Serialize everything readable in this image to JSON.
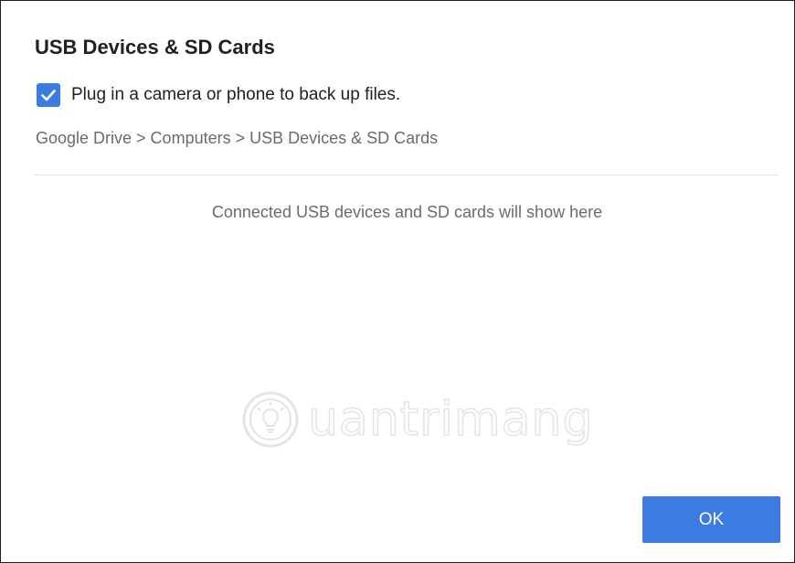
{
  "dialog": {
    "title": "USB Devices & SD Cards",
    "checkbox": {
      "checked": true,
      "label": "Plug in a camera or phone to back up files."
    },
    "breadcrumb": "Google Drive > Computers > USB Devices & SD Cards",
    "empty_message": "Connected USB devices and SD cards will show here",
    "ok_label": "OK"
  },
  "watermark": {
    "text": "uantrimang",
    "icon": "lightbulb-icon"
  },
  "colors": {
    "accent": "#3b7ce2",
    "title_text": "#202124",
    "secondary_text": "#6b6b6b",
    "divider": "#e2e2e2"
  }
}
